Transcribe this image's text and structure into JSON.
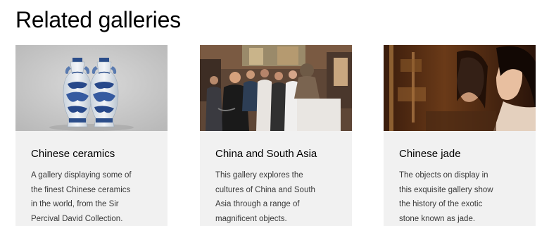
{
  "section": {
    "title": "Related galleries"
  },
  "cards": [
    {
      "title": "Chinese ceramics",
      "image_alt": "Pair of blue-and-white Chinese porcelain vases",
      "description_lines": [
        "A gallery displaying some of",
        "the finest Chinese ceramics",
        "in the world, from the Sir",
        "Percival David Collection."
      ]
    },
    {
      "title": "China and South Asia",
      "image_alt": "Visitors in a busy museum gallery",
      "description_lines": [
        "This gallery explores the",
        "cultures of China and South",
        "Asia through a range of",
        "magnificent objects."
      ]
    },
    {
      "title": "Chinese jade",
      "image_alt": "Visitor looking into a jade display case",
      "description_lines": [
        "The objects on display in",
        "this exquisite gallery show",
        "the history of the exotic",
        "stone known as jade."
      ]
    }
  ],
  "colors": {
    "card_background": "#f1f1f1",
    "title_text": "#000000",
    "body_text": "#3a3a3a"
  }
}
